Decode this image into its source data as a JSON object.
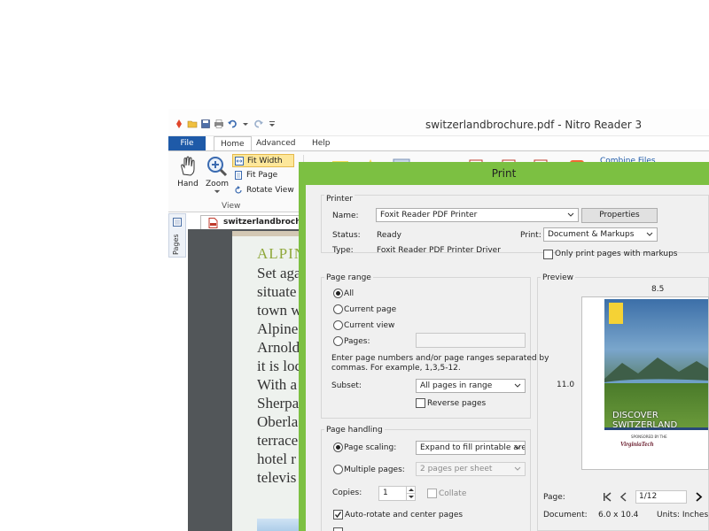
{
  "app": {
    "window_title": "switzerlandbrochure.pdf - Nitro Reader 3",
    "file_tab": "File",
    "tabs": [
      "Home",
      "Advanced",
      "Help"
    ],
    "tools": {
      "hand": "Hand",
      "zoom": "Zoom",
      "fit_width": "Fit Width",
      "fit_page": "Fit Page",
      "rotate_view": "Rotate View",
      "group_view": "View",
      "combine_files": "Combine Files"
    },
    "sidebar_label": "Pages",
    "document_tab": "switzerlandbrochure",
    "document": {
      "heading": "ALPIN",
      "lines": [
        "Set aga",
        "situate",
        "town w",
        "Alpine",
        "Arnold",
        "it is loc",
        "With a",
        "Sherpa",
        "Oberla",
        "terrace",
        "hotel r",
        "televis"
      ]
    }
  },
  "print_dialog": {
    "title": "Print",
    "printer": {
      "group_label": "Printer",
      "name_label": "Name:",
      "name_value": "Foxit Reader PDF Printer",
      "properties_button": "Properties",
      "status_label": "Status:",
      "status_value": "Ready",
      "type_label": "Type:",
      "type_value": "Foxit Reader PDF Printer Driver",
      "print_label": "Print:",
      "print_value": "Document & Markups",
      "only_markups_label": "Only print pages with markups"
    },
    "page_range": {
      "group_label": "Page range",
      "all": "All",
      "current_page": "Current page",
      "current_view": "Current view",
      "pages": "Pages:",
      "hint_line1": "Enter page numbers and/or page ranges separated by",
      "hint_line2": "commas. For example, 1,3,5-12.",
      "subset_label": "Subset:",
      "subset_value": "All pages in range",
      "reverse_pages": "Reverse pages"
    },
    "page_handling": {
      "group_label": "Page handling",
      "page_scaling": "Page scaling:",
      "page_scaling_value": "Expand to fill printable area",
      "multiple_pages": "Multiple pages:",
      "multiple_pages_value": "2 pages per sheet",
      "copies_label": "Copies:",
      "copies_value": "1",
      "collate": "Collate",
      "auto_rotate": "Auto-rotate and center pages"
    },
    "preview": {
      "group_label": "Preview",
      "width_label": "8.5",
      "height_label": "11.0",
      "brochure_line1": "DISCOVER",
      "brochure_line2": "SWITZERLAND",
      "brochure_sponsor": "SPONSORED BY THE",
      "brochure_logo": "VirginiaTech",
      "page_label": "Page:",
      "page_value": "1/12",
      "document_label": "Document:",
      "document_value": "6.0 x 10.4",
      "units_label": "Units: Inches"
    }
  },
  "colors": {
    "accent_blue": "#1e5aa8",
    "dialog_frame": "#7cc042",
    "heading_green": "#8fa83a",
    "selected_tool": "#fde79a"
  }
}
